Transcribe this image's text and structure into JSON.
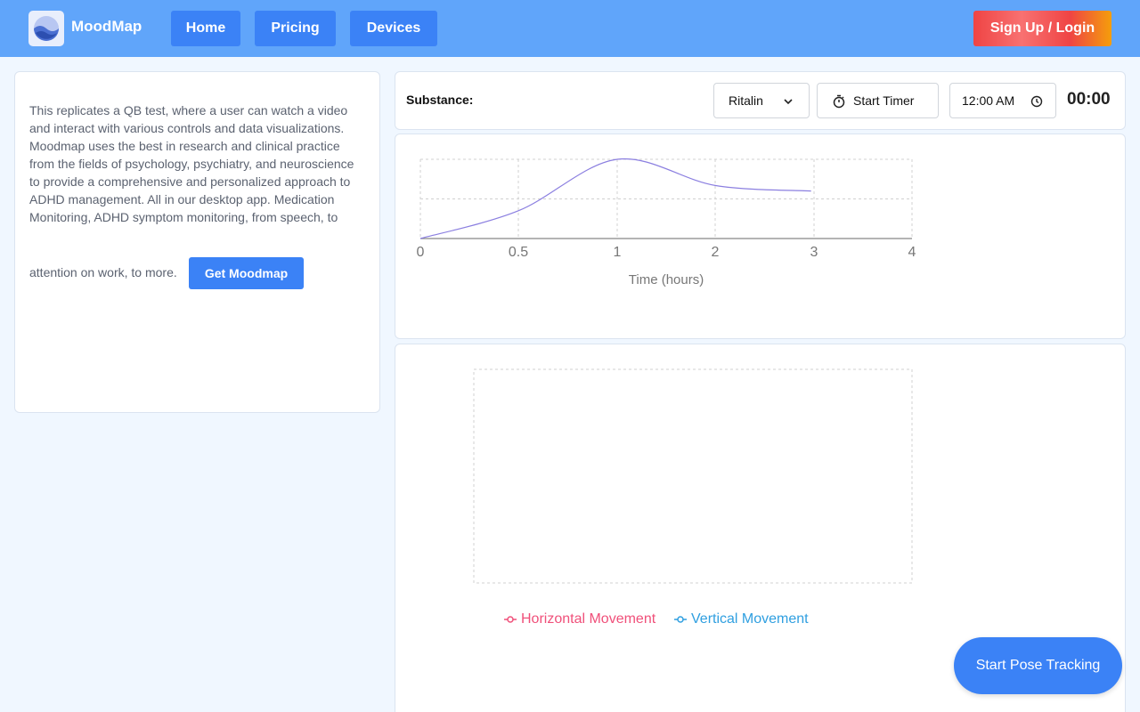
{
  "header": {
    "brand": "MoodMap",
    "nav": [
      {
        "label": "Home"
      },
      {
        "label": "Pricing"
      },
      {
        "label": "Devices"
      }
    ],
    "signup_label": "Sign Up / Login"
  },
  "intro": {
    "text": "This replicates a QB test, where a user can watch a video and interact with various controls and data visualizations. Moodmap uses the best in research and clinical practice from the fields of psychology, psychiatry, and neuroscience to provide a comprehensive and personalized approach to ADHD management. All in our desktop app. Medication Monitoring, ADHD symptom monitoring, from speech, to",
    "text_tail": "attention on work, to more.",
    "cta_label": "Get Moodmap"
  },
  "controls": {
    "substance_label": "Substance:",
    "substance_value": "Ritalin",
    "start_timer_label": "Start Timer",
    "time_value": "12:00 AM",
    "timer_display": "00:00"
  },
  "chart_data": [
    {
      "type": "line",
      "xlabel": "Time (hours)",
      "x_ticks": [
        "0",
        "0.5",
        "1",
        "2",
        "3",
        "4"
      ],
      "points": [
        [
          0,
          0
        ],
        [
          0.5,
          0.35
        ],
        [
          1,
          1.0
        ],
        [
          2,
          0.67
        ],
        [
          2.97,
          0.6
        ]
      ],
      "ylim": [
        0,
        1
      ],
      "grid": true,
      "line_color": "#8b7fe0"
    },
    {
      "type": "line",
      "series": [
        {
          "name": "Horizontal Movement",
          "values": [],
          "color": "#f0507a"
        },
        {
          "name": "Vertical Movement",
          "values": [],
          "color": "#2f9fe0"
        }
      ],
      "grid": true,
      "legend": "bottom"
    }
  ],
  "pose_button_label": "Start Pose Tracking",
  "icons": {
    "logo": "logo-icon",
    "dropdown": "chevron-down-icon",
    "timer": "stopwatch-icon",
    "clock": "clock-icon",
    "legend_marker": "line-circle-icon"
  }
}
